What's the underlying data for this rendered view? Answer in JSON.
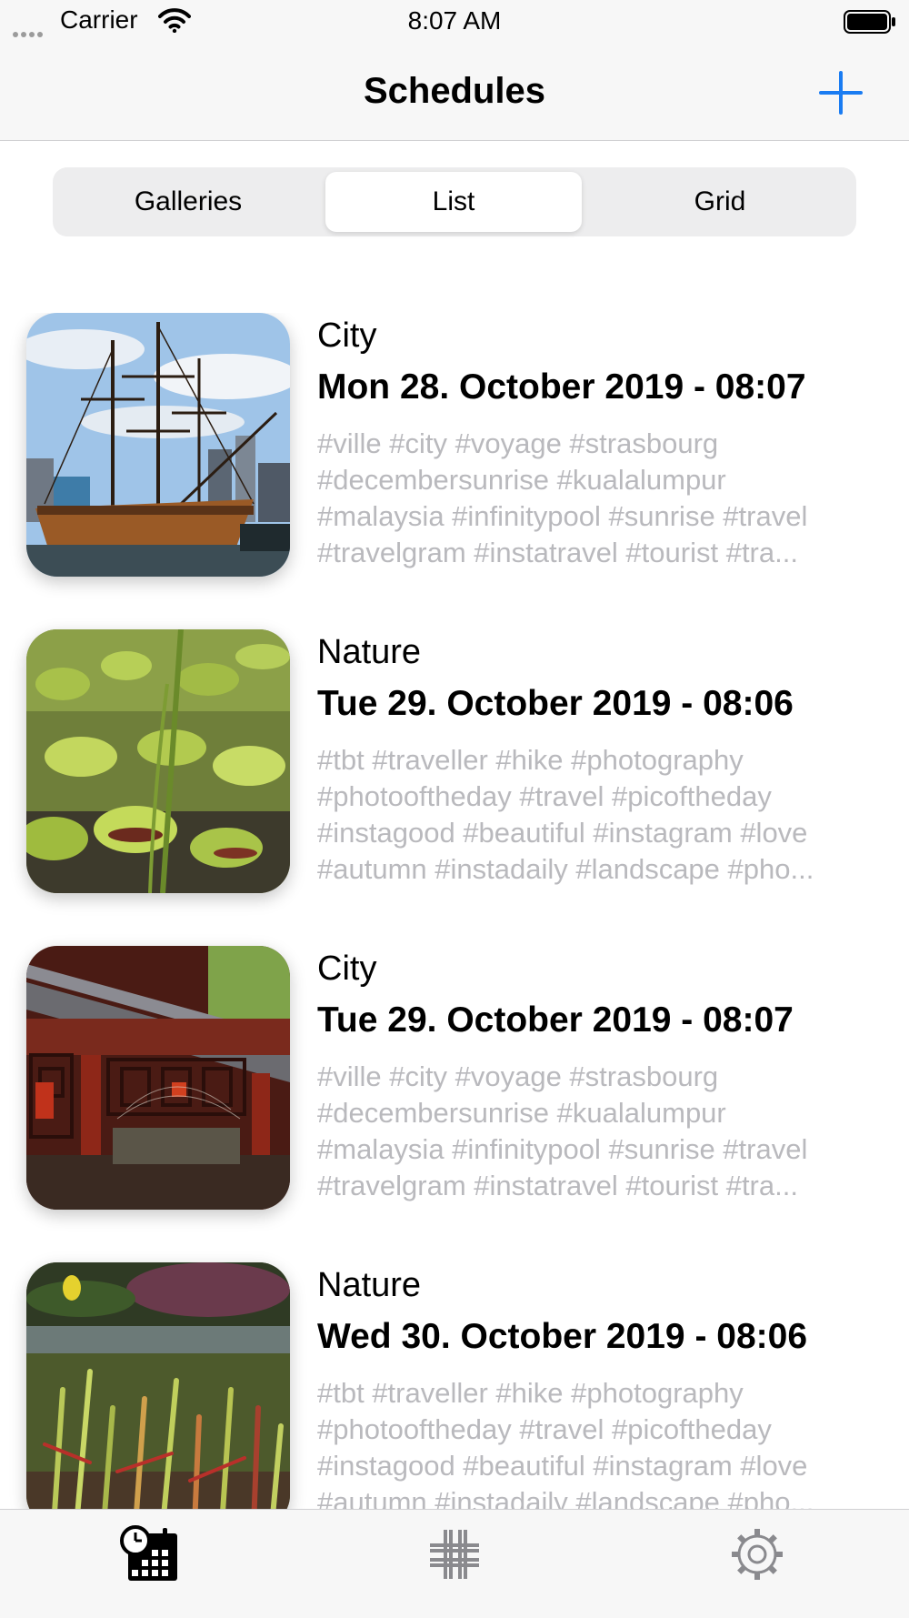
{
  "status_bar": {
    "carrier": "Carrier",
    "time": "8:07 AM"
  },
  "nav": {
    "title": "Schedules",
    "add_icon": "plus-icon"
  },
  "segments": [
    "Galleries",
    "List",
    "Grid"
  ],
  "selected_segment": "List",
  "schedules": [
    {
      "category": "City",
      "date": "Mon 28. October 2019 - 08:07",
      "image": "tall-ship-harbor-photo",
      "tags": [
        "#ville #city #voyage #strasbourg",
        "#decembersunrise #kualalumpur",
        "#malaysia #infinitypool #sunrise #travel",
        "#travelgram #instatravel #tourist #tra..."
      ]
    },
    {
      "category": "Nature",
      "date": "Tue 29. October 2019 - 08:06",
      "image": "venus-flytrap-photo",
      "tags": [
        "#tbt #traveller #hike #photography",
        "#photooftheday #travel #picoftheday",
        "#instagood #beautiful #instagram #love",
        "#autumn #instadaily #landscape #pho..."
      ]
    },
    {
      "category": "City",
      "date": "Tue 29. October 2019 - 08:07",
      "image": "chinese-pavilion-photo",
      "tags": [
        "#ville #city #voyage #strasbourg",
        "#decembersunrise #kualalumpur",
        "#malaysia #infinitypool #sunrise #travel",
        "#travelgram #instatravel #tourist #tra..."
      ]
    },
    {
      "category": "Nature",
      "date": "Wed 30. October 2019 - 08:06",
      "image": "pitcher-plants-photo",
      "tags": [
        "#tbt #traveller #hike #photography",
        "#photooftheday #travel #picoftheday",
        "#instagood #beautiful #instagram #love",
        "#autumn #instadaily #landscape #pho..."
      ]
    }
  ],
  "tabs": [
    {
      "icon": "calendar-clock-icon",
      "selected": true
    },
    {
      "icon": "hashtag-icon",
      "selected": false
    },
    {
      "icon": "gear-icon",
      "selected": false
    }
  ],
  "colors": {
    "accent": "#1a7cf2",
    "tag_gray": "#b9b9bd",
    "bar_bg": "#f7f7f7"
  }
}
